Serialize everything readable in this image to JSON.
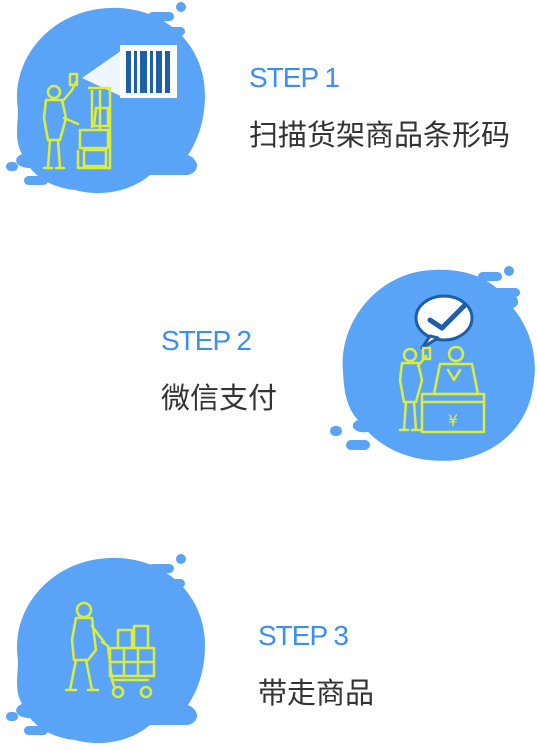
{
  "colors": {
    "accent": "#3b8ef5",
    "blob_fill": "#5aa4f7",
    "illustration_line": "#dcee3a",
    "barcode": "#1d5fa8",
    "text_dark": "#333333"
  },
  "steps": [
    {
      "title": "STEP 1",
      "desc": "扫描货架商品条形码",
      "icon": "scan-barcode-icon"
    },
    {
      "title": "STEP 2",
      "desc": "微信支付",
      "icon": "wechat-pay-icon"
    },
    {
      "title": "STEP 3",
      "desc": "带走商品",
      "icon": "shopping-cart-icon"
    }
  ],
  "illustration": {
    "currency_symbol": "¥"
  }
}
